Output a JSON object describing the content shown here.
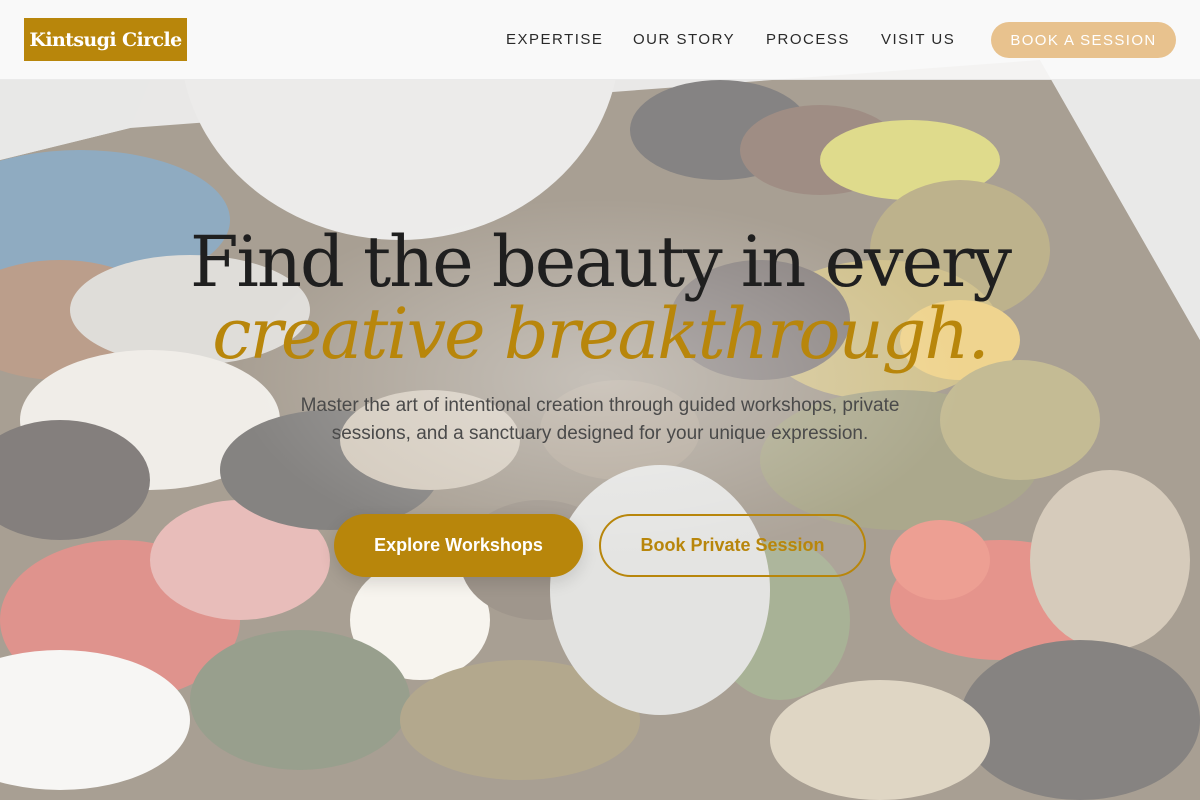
{
  "header": {
    "logo_text": "Kintsugi Circle",
    "nav": [
      {
        "label": "EXPERTISE"
      },
      {
        "label": "OUR STORY"
      },
      {
        "label": "PROCESS"
      },
      {
        "label": "VISIT US"
      }
    ],
    "cta_label": "BOOK A SESSION"
  },
  "hero": {
    "headline": "Find the beauty in every",
    "headline_accent": "creative breakthrough.",
    "subtext": "Master the art of intentional creation through guided workshops, private sessions, and a sanctuary designed for your unique expression.",
    "primary_button": "Explore Workshops",
    "secondary_button": "Book Private Session",
    "background_image": "paint-palette-photo"
  },
  "colors": {
    "accent": "#b8860b",
    "cta_pill": "#e8c28e",
    "heading": "#1f1f1f",
    "body_text": "#4a4a4a"
  }
}
